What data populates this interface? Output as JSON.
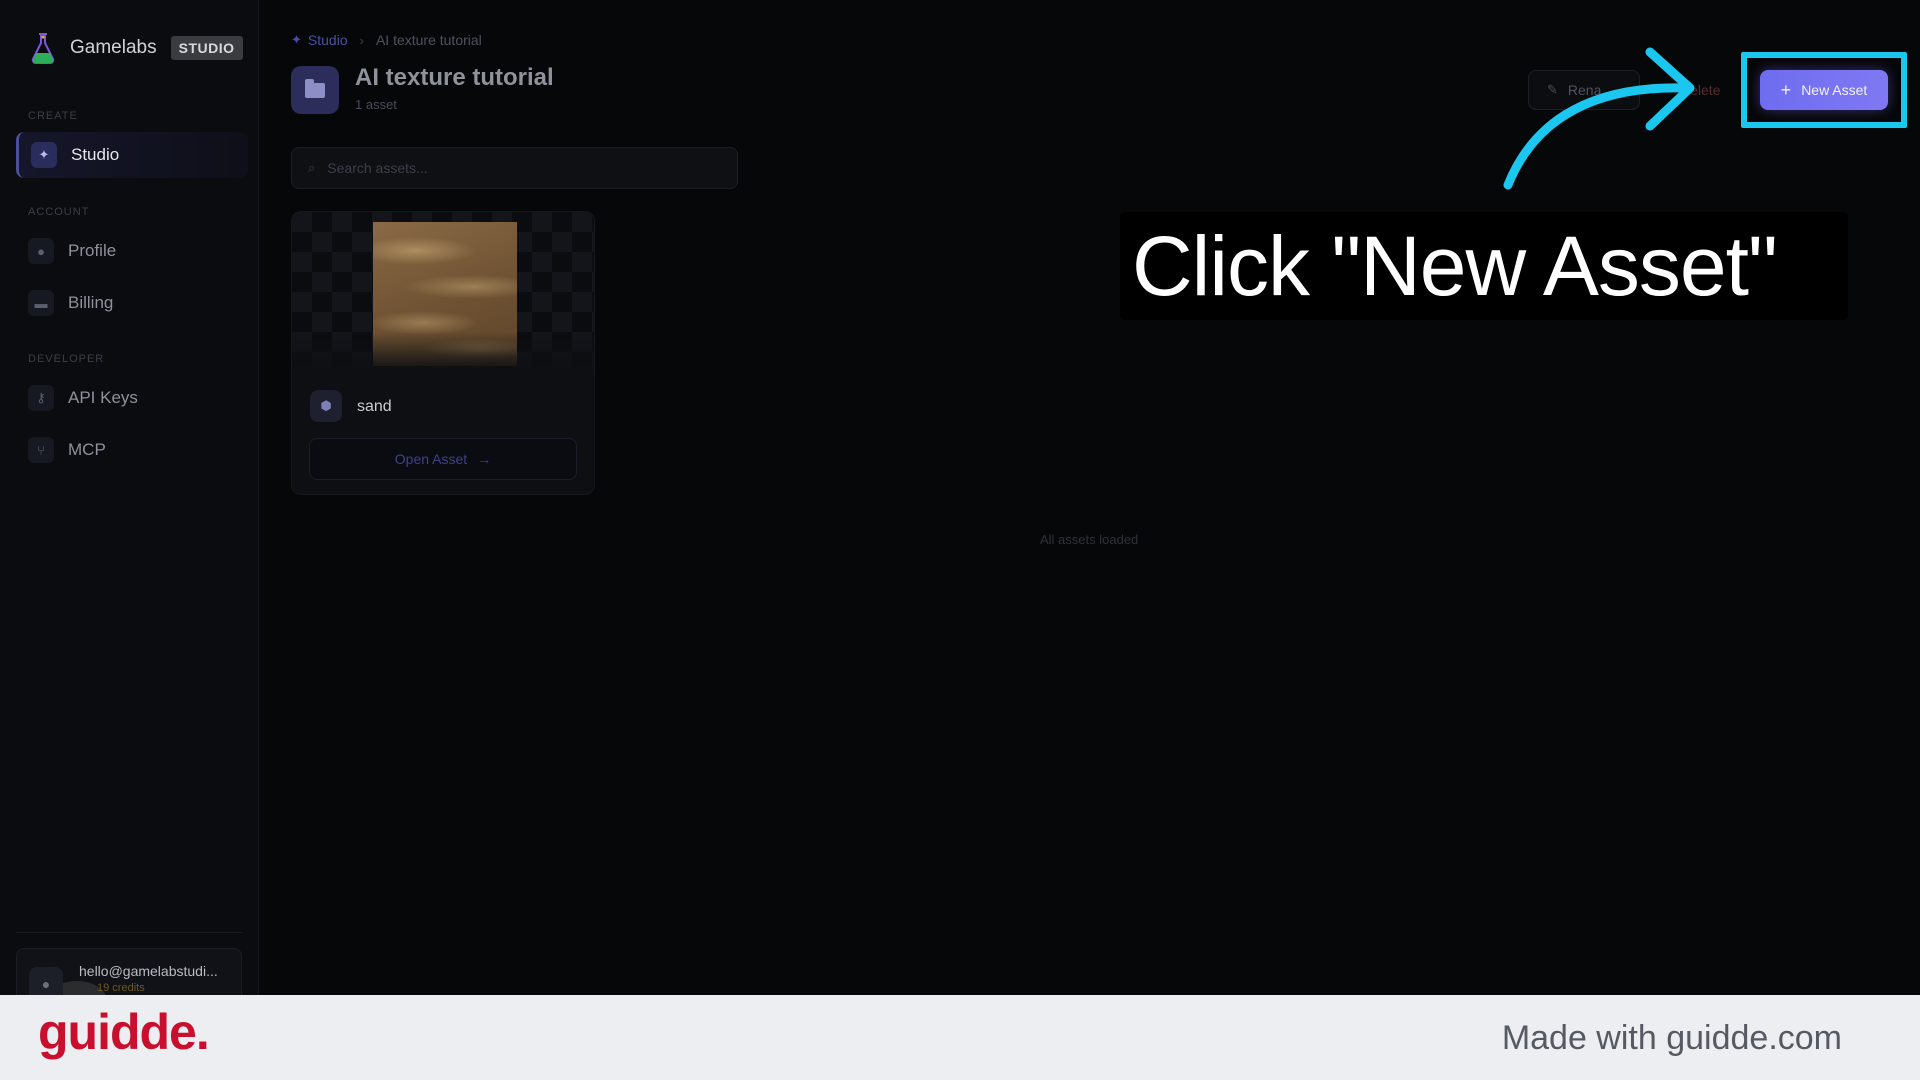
{
  "brand": {
    "name": "Gamelabs",
    "badge": "STUDIO"
  },
  "sidebar": {
    "sections": [
      {
        "label": "CREATE"
      },
      {
        "label": "ACCOUNT"
      },
      {
        "label": "DEVELOPER"
      }
    ],
    "items": [
      {
        "label": "Studio",
        "icon": "magic-wand-icon",
        "active": true
      },
      {
        "label": "Profile",
        "icon": "user-icon",
        "active": false
      },
      {
        "label": "Billing",
        "icon": "credit-card-icon",
        "active": false
      },
      {
        "label": "API Keys",
        "icon": "key-icon",
        "active": false
      },
      {
        "label": "MCP",
        "icon": "git-branch-icon",
        "active": false
      }
    ],
    "user": {
      "email": "hello@gamelabstudi...",
      "credits": "19 credits"
    }
  },
  "breadcrumb": {
    "root": "Studio",
    "current": "AI texture tutorial"
  },
  "header": {
    "title": "AI texture tutorial",
    "subtitle": "1 asset",
    "rename_label": "Rena",
    "delete_label": "Delete",
    "new_asset_label": "New Asset"
  },
  "search": {
    "placeholder": "Search assets..."
  },
  "assets": [
    {
      "name": "sand",
      "open_label": "Open Asset"
    }
  ],
  "status": {
    "loaded_text": "All assets loaded"
  },
  "annotation": {
    "text": "Click \"New Asset\"",
    "accent": "#1bc6ef"
  },
  "footer": {
    "logo": "guidde.",
    "made_with": "Made with guidde.com"
  },
  "colors": {
    "accent": "#7471f1",
    "brand_red": "#c8102e"
  }
}
